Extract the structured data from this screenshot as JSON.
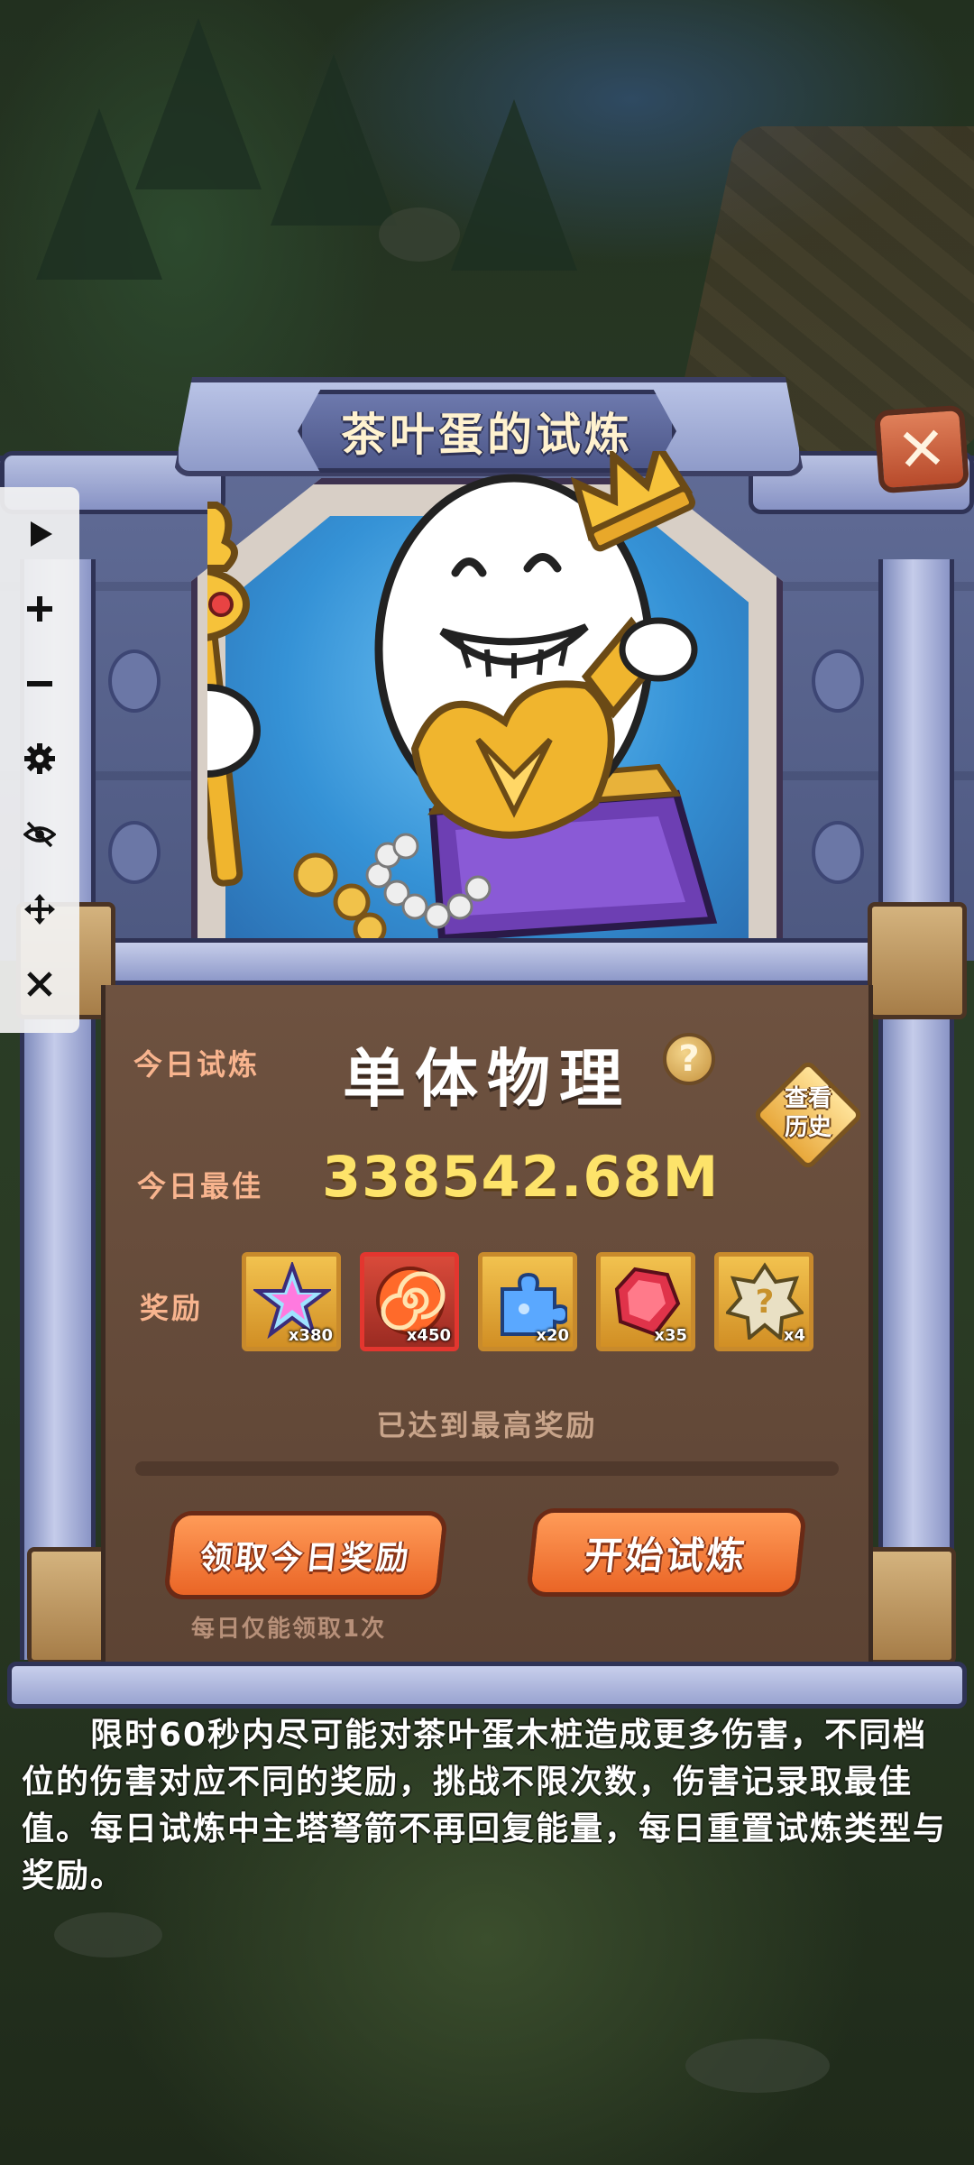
{
  "toolbar": {
    "items": [
      {
        "name": "play-icon",
        "glyph": "▶"
      },
      {
        "name": "zoom-in-icon",
        "glyph": "+"
      },
      {
        "name": "zoom-out-icon",
        "glyph": "−"
      },
      {
        "name": "settings-icon",
        "glyph": "⚙"
      },
      {
        "name": "hide-icon",
        "glyph": "eye-off"
      },
      {
        "name": "move-icon",
        "glyph": "✥"
      },
      {
        "name": "close-icon",
        "glyph": "✕"
      }
    ]
  },
  "panel": {
    "title": "茶叶蛋的试炼",
    "close_glyph": "✕"
  },
  "today_trial": {
    "label": "今日试炼",
    "value": "单体物理",
    "help_glyph": "?"
  },
  "history": {
    "label_line1": "查看",
    "label_line2": "历史"
  },
  "today_best": {
    "label": "今日最佳",
    "value": "338542.68M"
  },
  "rewards": {
    "label": "奖励",
    "items": [
      {
        "icon": "star-crystal-icon",
        "qty": "x380"
      },
      {
        "icon": "swirl-candy-icon",
        "qty": "x450"
      },
      {
        "icon": "puzzle-piece-icon",
        "qty": "x20"
      },
      {
        "icon": "red-gem-icon",
        "qty": "x35"
      },
      {
        "icon": "mystery-box-icon",
        "qty": "x4"
      }
    ],
    "status": "已达到最高奖励"
  },
  "buttons": {
    "claim": "领取今日奖励",
    "start": "开始试炼",
    "claim_note": "每日仅能领取1次"
  },
  "description": "限时60秒内尽可能对茶叶蛋木桩造成更多伤害，不同档位的伤害对应不同的奖励，挑战不限次数，伤害记录取最佳值。每日试炼中主塔弩箭不再回复能量，每日重置试炼类型与奖励。",
  "colors": {
    "accent_orange": "#ea6526",
    "score_yellow": "#fde36a",
    "label_salmon": "#f8b48e"
  }
}
